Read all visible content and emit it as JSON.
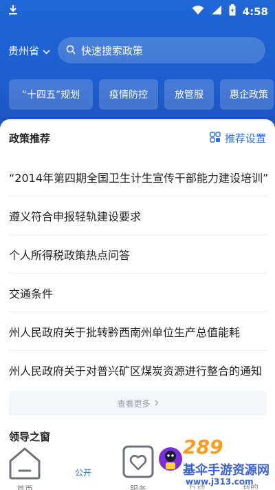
{
  "status_bar": {
    "time": "4:58",
    "icons": [
      "download-icon",
      "wifi-icon",
      "signal-icon",
      "battery-icon"
    ]
  },
  "header": {
    "region": "贵州省",
    "search_placeholder": "快速搜索政策"
  },
  "categories": [
    "“十四五”规划",
    "疫情防控",
    "放管服",
    "惠企政策"
  ],
  "recommend": {
    "title": "政策推荐",
    "settings_label": "推荐设置",
    "items": [
      "“2014年第四期全国卫生计生宣传干部能力建设培训”",
      "遵义符合申报轻轨建设要求",
      "个人所得税政策热点问答",
      "交通条件",
      "州人民政府关于批转黔西南州单位生产总值能耗",
      "州人民政府关于对普兴矿区煤炭资源进行整合的通知"
    ],
    "more_label": "查看更多"
  },
  "leader_section": {
    "title": "领导之窗"
  },
  "tabbar": {
    "tabs": [
      {
        "label": "首页",
        "icon": "home-icon"
      },
      {
        "label": "公开",
        "icon": "open-icon",
        "active": true
      },
      {
        "label": "服务",
        "icon": "service-icon"
      },
      {
        "label": "互动",
        "icon": "interact-icon"
      },
      {
        "label": "我的",
        "icon": "profile-icon"
      }
    ]
  },
  "watermark": {
    "number": "289",
    "site_name": "基伞手游资源网",
    "url": "www.j313.com"
  },
  "colors": {
    "primary": "#1f67d6",
    "accent": "#2b6fe0",
    "text": "#222222"
  }
}
